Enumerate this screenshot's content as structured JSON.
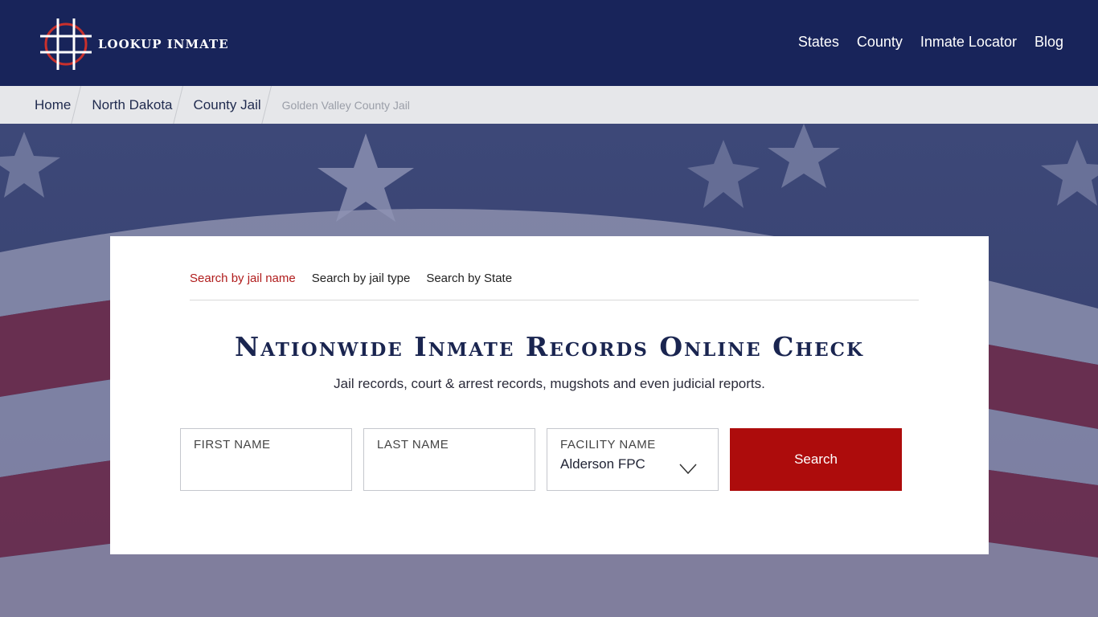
{
  "header": {
    "logo_text": "LOOKUP INMATE",
    "nav": [
      "States",
      "County",
      "Inmate Locator",
      "Blog"
    ]
  },
  "breadcrumb": [
    "Home",
    "North Dakota",
    "County Jail",
    "Golden Valley County Jail"
  ],
  "search": {
    "tabs": [
      "Search by jail name",
      "Search by jail type",
      "Search by State"
    ],
    "active_tab": "Search by jail name",
    "title": "Nationwide Inmate Records Online Check",
    "subtitle": "Jail records, court & arrest records, mugshots and even judicial reports.",
    "fields": {
      "first_name_label": "FIRST NAME",
      "last_name_label": "LAST NAME",
      "facility_label": "FACILITY NAME",
      "facility_value": "Alderson FPC"
    },
    "button_label": "Search"
  },
  "colors": {
    "header_bg": "#18245a",
    "accent": "#ad0c0c",
    "breadcrumb_bg": "#e6e7ea"
  }
}
